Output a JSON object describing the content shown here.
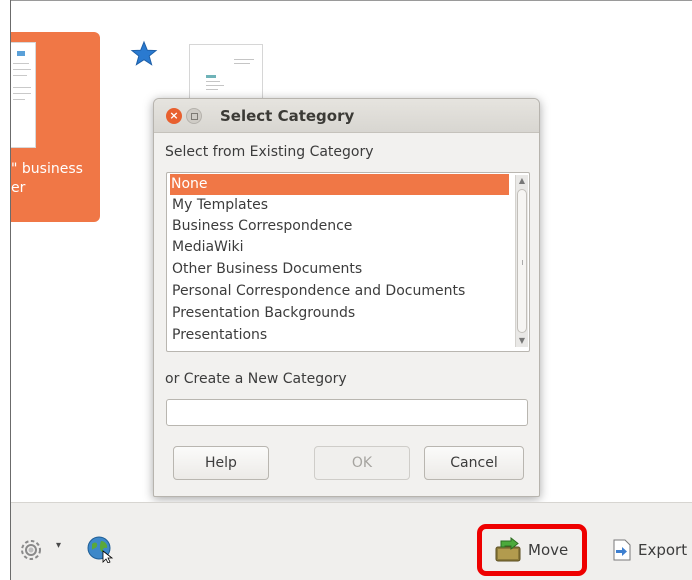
{
  "background_window": {
    "selected_template": {
      "caption_line1": "\" business",
      "caption_line2": "er"
    }
  },
  "dialog": {
    "title": "Select Category",
    "existing_label": "Select from Existing Category",
    "categories": [
      "None",
      "My Templates",
      "Business Correspondence",
      "MediaWiki",
      "Other Business Documents",
      "Personal Correspondence and Documents",
      "Presentation Backgrounds",
      "Presentations"
    ],
    "selected_category": "None",
    "new_category_label": "or Create a New Category",
    "new_category_value": "",
    "buttons": {
      "help": "Help",
      "ok": "OK",
      "cancel": "Cancel"
    }
  },
  "toolbar": {
    "move_label": "Move",
    "export_label": "Export"
  },
  "colors": {
    "accent": "#f07746",
    "highlight": "#ee0000",
    "star": "#2a7ad0"
  }
}
